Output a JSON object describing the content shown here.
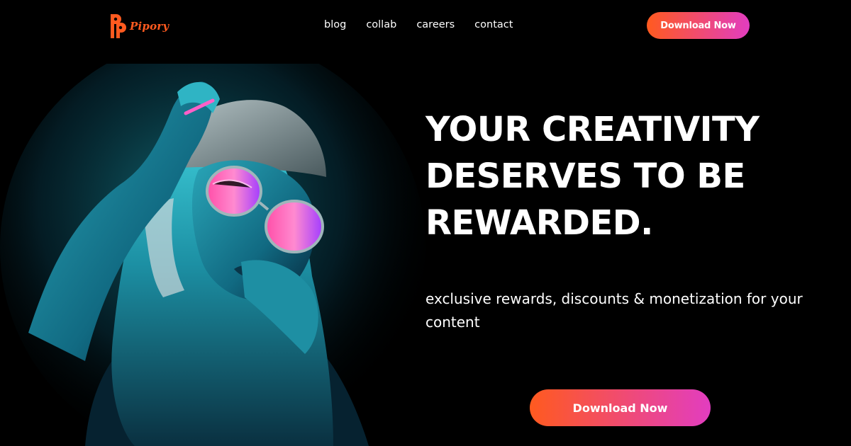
{
  "brand": {
    "name": "Pipory",
    "color": "#ff5a1f"
  },
  "nav": {
    "items": [
      {
        "label": "blog"
      },
      {
        "label": "collab"
      },
      {
        "label": "careers"
      },
      {
        "label": "contact"
      }
    ]
  },
  "header": {
    "cta_label": "Download Now"
  },
  "hero": {
    "headline_line1": "YOUR CREATIVITY",
    "headline_line2": "DESERVES TO BE",
    "headline_line3": "REWARDED.",
    "subtext": "exclusive rewards, discounts & monetization for your content",
    "cta_label": "Download Now",
    "image_icon": "woman-neon-glasses-portrait"
  },
  "colors": {
    "background": "#000000",
    "text": "#ffffff",
    "gradient_start": "#ff5a1f",
    "gradient_end": "#e23dc0"
  }
}
